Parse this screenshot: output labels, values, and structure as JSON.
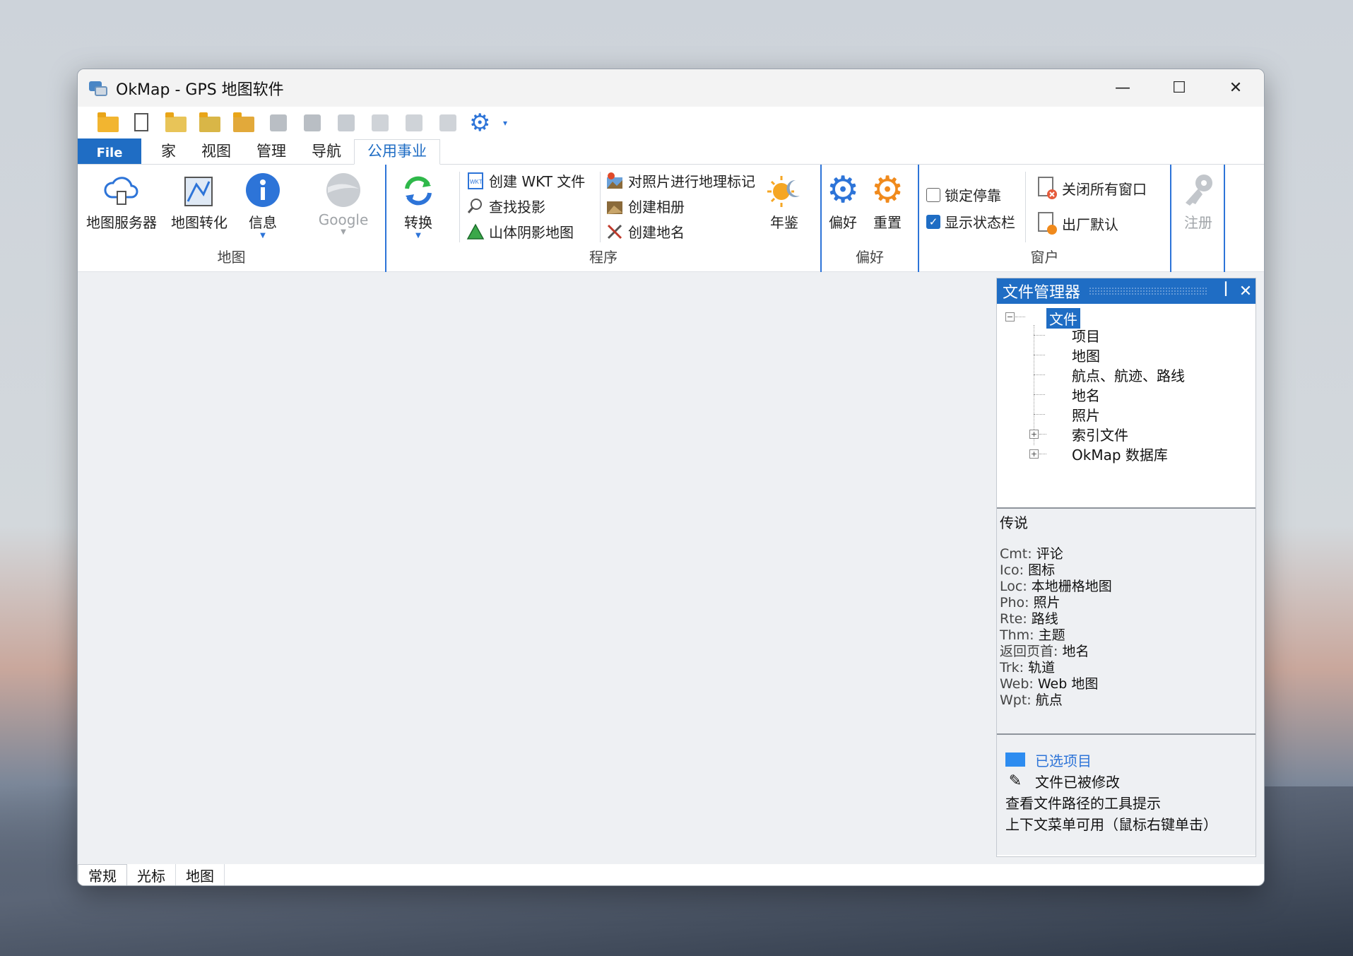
{
  "window": {
    "title": "OkMap - GPS 地图软件",
    "minimize": "—",
    "maximize": "☐",
    "close": "✕"
  },
  "tabs": [
    {
      "label": "File"
    },
    {
      "label": "家"
    },
    {
      "label": "视图"
    },
    {
      "label": "管理"
    },
    {
      "label": "导航"
    },
    {
      "label": "公用事业"
    }
  ],
  "ribbon": {
    "map_group": {
      "label": "地图",
      "buttons": [
        "地图服务器",
        "地图转化",
        "信息",
        "Google"
      ]
    },
    "program_group": {
      "label": "程序",
      "convert": "转换",
      "col1": [
        "创建 WKT 文件",
        "查找投影",
        "山体阴影地图"
      ],
      "col2": [
        "对照片进行地理标记",
        "创建相册",
        "创建地名"
      ],
      "yearbook": "年鉴"
    },
    "pref_group": {
      "label": "偏好",
      "buttons": [
        "偏好",
        "重置"
      ]
    },
    "window_group": {
      "label": "窗户",
      "checks": [
        {
          "label": "锁定停靠",
          "checked": false
        },
        {
          "label": "显示状态栏",
          "checked": true
        }
      ],
      "buttons": [
        "关闭所有窗口",
        "出厂默认"
      ]
    },
    "register": "注册"
  },
  "file_manager": {
    "title": "文件管理器",
    "pin": "ꟾ",
    "close": "✕",
    "root": "文件",
    "children": [
      "项目",
      "地图",
      "航点、航迹、路线",
      "地名",
      "照片",
      "索引文件",
      "OkMap 数据库"
    ],
    "legend_title": "传说",
    "legend": [
      {
        "k": "Cmt:",
        "v": "评论"
      },
      {
        "k": "Ico:",
        "v": "图标"
      },
      {
        "k": "Loc:",
        "v": "本地栅格地图"
      },
      {
        "k": "Pho:",
        "v": "照片"
      },
      {
        "k": "Rte:",
        "v": "路线"
      },
      {
        "k": "Thm:",
        "v": "主题"
      },
      {
        "k": "返回页首:",
        "v": "地名"
      },
      {
        "k": "Trk:",
        "v": "轨道"
      },
      {
        "k": "Web:",
        "v": "Web 地图"
      },
      {
        "k": "Wpt:",
        "v": "航点"
      }
    ],
    "notes": [
      "已选项目",
      "文件已被修改",
      "查看文件路径的工具提示",
      "上下文菜单可用（鼠标右键单击）"
    ]
  },
  "status_tabs": [
    "常规",
    "光标",
    "地图"
  ]
}
